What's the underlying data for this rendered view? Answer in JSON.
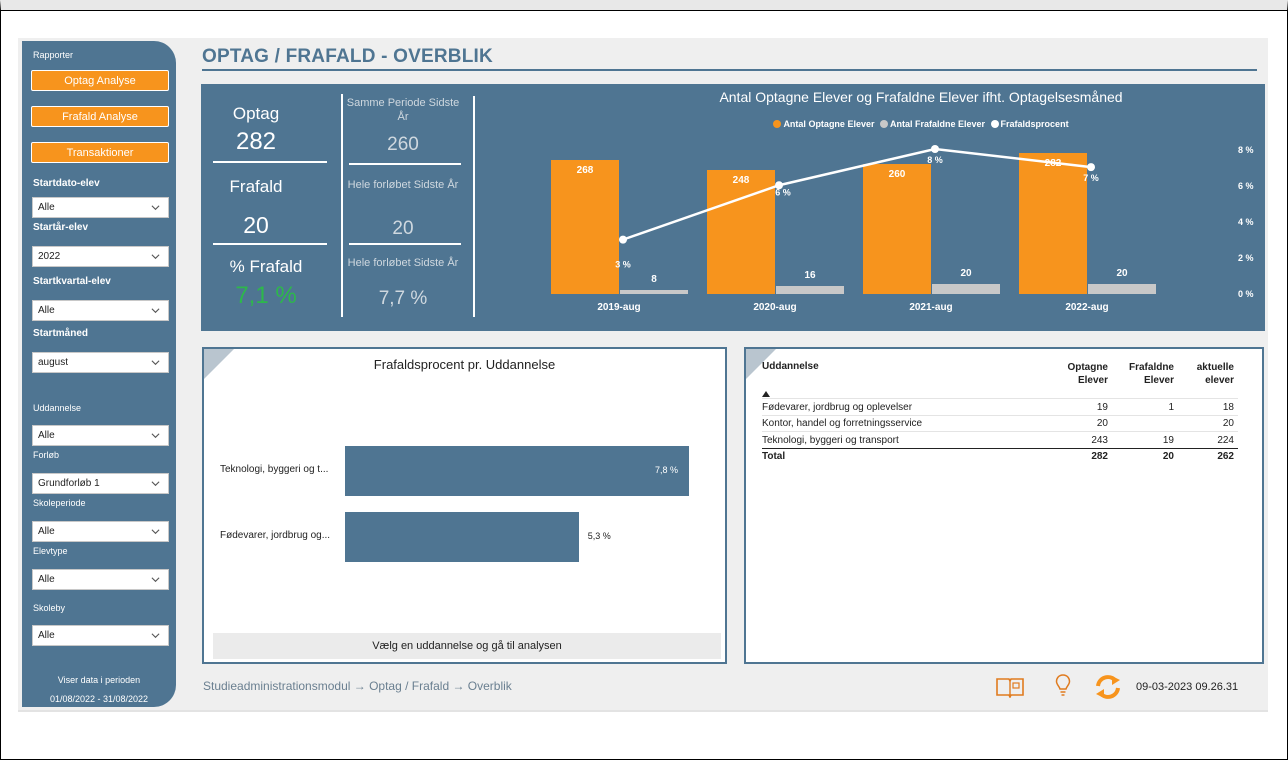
{
  "page": {
    "title": "OPTAG / FRAFALD - OVERBLIK"
  },
  "sidebar": {
    "reports_label": "Rapporter",
    "buttons": [
      "Optag Analyse",
      "Frafald Analyse",
      "Transaktioner"
    ],
    "filters": [
      {
        "label": "Startdato-elev",
        "value": "Alle"
      },
      {
        "label": "Startår-elev",
        "value": "2022"
      },
      {
        "label": "Startkvartal-elev",
        "value": "Alle"
      },
      {
        "label": "Startmåned",
        "value": "august"
      },
      {
        "label": "Uddannelse",
        "value": "Alle"
      },
      {
        "label": "Forløb",
        "value": "Grundforløb 1"
      },
      {
        "label": "Skoleperiode",
        "value": "Alle"
      },
      {
        "label": "Elevtype",
        "value": "Alle"
      },
      {
        "label": "Skoleby",
        "value": "Alle"
      }
    ],
    "footer_line1": "Viser data i perioden",
    "footer_line2": "01/08/2022 - 31/08/2022"
  },
  "kpi": {
    "optag_label": "Optag",
    "optag_value": "282",
    "frafald_label": "Frafald",
    "frafald_value": "20",
    "pct_label": "% Frafald",
    "pct_value": "7,1 %",
    "cmp1_label": "Samme Periode Sidste År",
    "cmp1_value": "260",
    "cmp2_label": "Hele forløbet Sidste År",
    "cmp2_value": "20",
    "cmp3_label": "Hele forløbet Sidste År",
    "cmp3_value": "7,7 %",
    "pct_color": "#2db84b"
  },
  "chart_data": [
    {
      "type": "bar",
      "title": "Antal Optagne Elever og Frafaldne Elever ifht. Optagelsesmåned",
      "categories": [
        "2019-aug",
        "2020-aug",
        "2021-aug",
        "2022-aug"
      ],
      "series": [
        {
          "name": "Antal Optagne Elever",
          "values": [
            268,
            248,
            260,
            282
          ],
          "color": "#f7941d"
        },
        {
          "name": "Antal Frafaldne Elever",
          "values": [
            8,
            16,
            20,
            20
          ],
          "color": "#c8c8c8"
        },
        {
          "name": "Frafaldsprocent",
          "type": "line",
          "values": [
            3,
            6,
            8,
            7
          ],
          "color": "#ffffff"
        }
      ],
      "y2_ticks": [
        "8 %",
        "6 %",
        "4 %",
        "2 %",
        "0 %"
      ],
      "y2_lim": [
        0,
        8
      ],
      "legend": "top-center"
    },
    {
      "type": "bar",
      "orientation": "horizontal",
      "title": "Frafaldsprocent pr. Uddannelse",
      "categories": [
        "Teknologi, byggeri og t...",
        "Fødevarer, jordbrug og..."
      ],
      "values": [
        7.8,
        5.3
      ],
      "value_labels": [
        "7,8 %",
        "5,3 %"
      ],
      "color": "#4f7592"
    }
  ],
  "bar_panel": {
    "footer": "Vælg en uddannelse og gå til analysen"
  },
  "table": {
    "headers": [
      "Uddannelse",
      "Optagne Elever",
      "Frafaldne Elever",
      "aktuelle elever"
    ],
    "rows": [
      [
        "Fødevarer, jordbrug og oplevelser",
        "19",
        "1",
        "18"
      ],
      [
        "Kontor, handel og forretningsservice",
        "20",
        "",
        "20"
      ],
      [
        "Teknologi, byggeri og transport",
        "243",
        "19",
        "224"
      ]
    ],
    "total": [
      "Total",
      "282",
      "20",
      "262"
    ]
  },
  "footer": {
    "breadcrumb": "Studieadministrationsmodul → Optag / Frafald → Overblik",
    "timestamp": "09-03-2023 09.26.31",
    "icons": [
      "book-icon",
      "lightbulb-icon",
      "refresh-icon"
    ]
  }
}
